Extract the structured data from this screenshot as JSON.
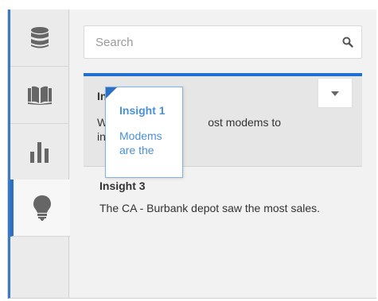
{
  "rail": {
    "tabs": [
      {
        "name": "data",
        "icon": "database-icon",
        "active": false
      },
      {
        "name": "library",
        "icon": "book-icon",
        "active": false
      },
      {
        "name": "visualizations",
        "icon": "bar-chart-icon",
        "active": false
      },
      {
        "name": "insights",
        "icon": "lightbulb-icon",
        "active": true
      }
    ]
  },
  "search": {
    "placeholder": "Search",
    "value": ""
  },
  "insight_group": {
    "title_fragment": "In",
    "body_fragment_left": "W",
    "body_fragment_right": "ost modems to",
    "body_fragment_line2": "in"
  },
  "drag_card": {
    "title": "Insight 1",
    "body": "Modems are the"
  },
  "insight_3": {
    "title": "Insight 3",
    "body": "The CA - Burbank depot saw the most sales."
  },
  "colors": {
    "accent": "#1f6fd1",
    "accent_light": "#4a90d9",
    "icon_gray": "#666666"
  }
}
